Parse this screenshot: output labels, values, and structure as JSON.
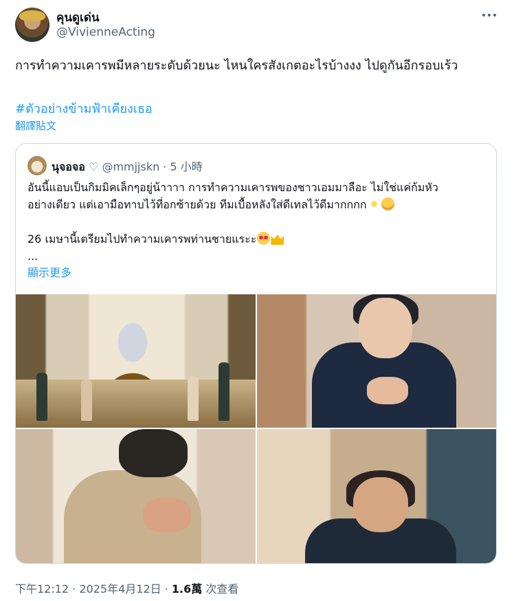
{
  "author": {
    "display_name": "คุนดูเด่น",
    "handle": "@VivienneActing"
  },
  "tweet": {
    "text": "การทำความเคารพมีหลายระดับด้วยนะ ไหนใครสังเกตอะไรบ้างงง ไปดูกันอีกรอบเร้ว",
    "hashtag": "#ตัวอย่างข้ามฟ้าเคียงเธอ",
    "translate_label": "翻譯貼文"
  },
  "quote": {
    "display_name": "นุจอจอ",
    "name_icon": "♡",
    "handle": "@mmjjskn",
    "separator": " · ",
    "time": "5 小時",
    "lines": [
      "อันนี้แอบเป็นกิมมิคเล็กๆอยู่น้าาาา การทำความเคารพของชาวเอมมาลือะ ไม่ใช่แค่ก้มหัว",
      "อย่างเดียว แต่เอามือทาบไว้ที่อกซ้ายด้วย ทีมเบื้อหลังใส่ดีเทลไว้ดีมากกกก",
      "",
      "26 เมษานี้เตรียมไปทำความเคารพท่านชายแระะ",
      "..."
    ],
    "show_more": "顯示更多"
  },
  "footer": {
    "time": "下午12:12",
    "separator": " · ",
    "date": "2025年4月12日",
    "views_count": "1.6萬",
    "views_label": " 次查看"
  },
  "icons": {
    "more": "more-horizontal-icon",
    "emoji_1": "sparkles-icon",
    "emoji_2": "holding-back-tears-icon",
    "emoji_3": "heart-eyes-icon",
    "emoji_4": "crown-icon"
  },
  "colors": {
    "accent": "#1d9bf0",
    "secondary_text": "#536471",
    "border": "#cfd9de"
  }
}
